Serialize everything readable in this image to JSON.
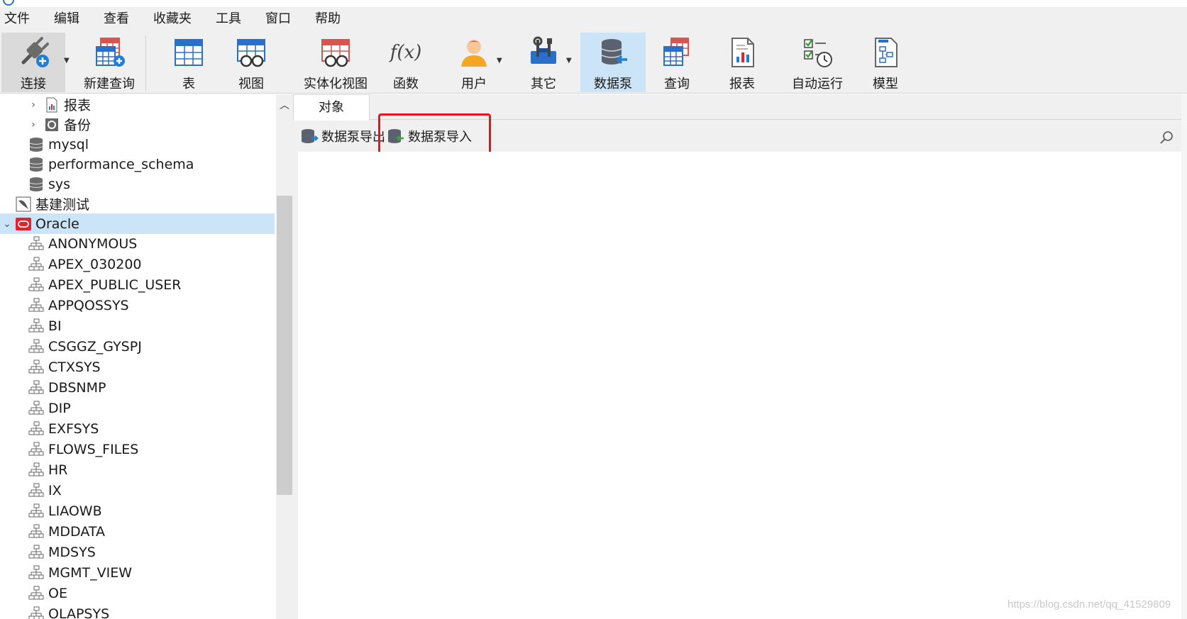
{
  "menu": [
    "文件",
    "编辑",
    "查看",
    "收藏夹",
    "工具",
    "窗口",
    "帮助"
  ],
  "toolbar": {
    "connect": "连接",
    "new_query": "新建查询",
    "table": "表",
    "view": "视图",
    "materialized_view": "实体化视图",
    "function": "函数",
    "function_glyph": "f(x)",
    "user": "用户",
    "other": "其它",
    "data_pump": "数据泵",
    "query": "查询",
    "report": "报表",
    "automation": "自动运行",
    "model": "模型"
  },
  "tree": {
    "report": "报表",
    "backup": "备份",
    "mysql": "mysql",
    "performance_schema": "performance_schema",
    "sys": "sys",
    "jijian": "基建测试",
    "oracle": "Oracle",
    "schemas": [
      "ANONYMOUS",
      "APEX_030200",
      "APEX_PUBLIC_USER",
      "APPQOSSYS",
      "BI",
      "CSGGZ_GYSPJ",
      "CTXSYS",
      "DBSNMP",
      "DIP",
      "EXFSYS",
      "FLOWS_FILES",
      "HR",
      "IX",
      "LIAOWB",
      "MDDATA",
      "MDSYS",
      "MGMT_VIEW",
      "OE",
      "OLAPSYS"
    ]
  },
  "tabs": {
    "objects": "对象"
  },
  "objbar": {
    "export": "数据泵导出",
    "import": "数据泵导入"
  },
  "watermark": "https://blog.csdn.net/qq_41529809",
  "colors": {
    "selected": "#cce4f7",
    "highlight": "#e8141b",
    "oracle_red": "#e5212c"
  }
}
